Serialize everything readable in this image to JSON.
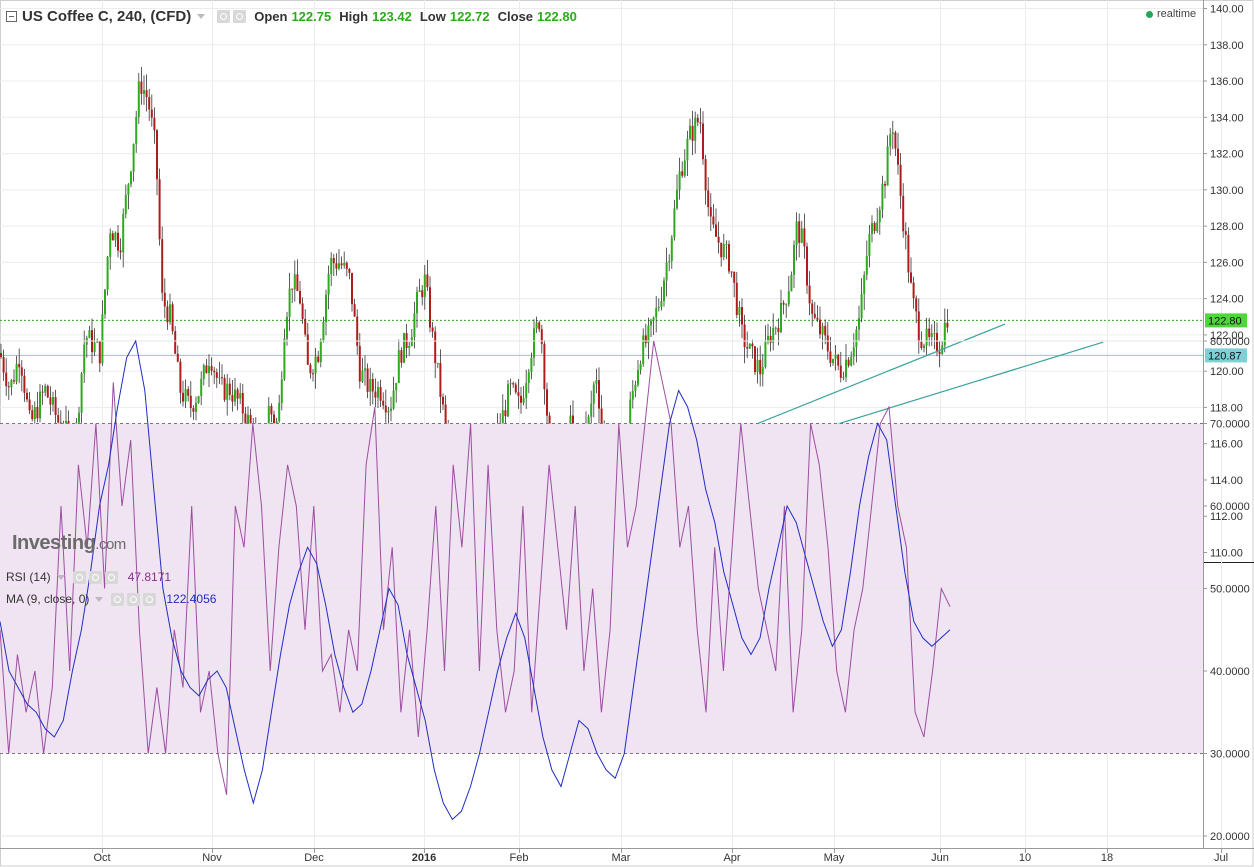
{
  "header": {
    "title": "US Coffee C, 240, (CFD)",
    "open_label": "Open",
    "open_value": "122.75",
    "high_label": "High",
    "high_value": "123.42",
    "low_label": "Low",
    "low_value": "122.72",
    "close_label": "Close",
    "close_value": "122.80",
    "realtime_label": "realtime"
  },
  "rsi_header": {
    "label": "RSI (14)",
    "value": "47.8171"
  },
  "ma_header": {
    "label": "MA (9, close, 0)",
    "value": "122.4056"
  },
  "logo": {
    "main": "Investing",
    "suffix": ".com"
  },
  "colors": {
    "up": "#2daa1d",
    "down": "#b01c1c",
    "rsi": "#9b4ea0",
    "ma": "#1f2ec2",
    "rsi_band": "#f0e4f2",
    "trend": "#3aa39a",
    "price_tag": "#4ed63a",
    "level_tag": "#7fcfd6"
  },
  "chart_data": [
    {
      "type": "candlestick",
      "title": "US Coffee C, 240, (CFD)",
      "x_ticks": [
        "Oct",
        "Nov",
        "Dec",
        "2016",
        "Feb",
        "Mar",
        "Apr",
        "May",
        "Jun",
        "10",
        "18",
        "Jul"
      ],
      "ylim": [
        109.5,
        140.5
      ],
      "y_ticks": [
        "110.00",
        "112.00",
        "114.00",
        "116.00",
        "118.00",
        "120.00",
        "122.00",
        "124.00",
        "126.00",
        "128.00",
        "130.00",
        "132.00",
        "134.00",
        "136.00",
        "138.00",
        "140.00"
      ],
      "current_price": "122.80",
      "level_line": "120.87",
      "grid": true,
      "path_series": [
        [
          0,
          121
        ],
        [
          10,
          119
        ],
        [
          20,
          121
        ],
        [
          30,
          117
        ],
        [
          45,
          119
        ],
        [
          60,
          117
        ],
        [
          75,
          116
        ],
        [
          85,
          122
        ],
        [
          100,
          121
        ],
        [
          110,
          128
        ],
        [
          120,
          127
        ],
        [
          132,
          132
        ],
        [
          140,
          136
        ],
        [
          148,
          135
        ],
        [
          156,
          132
        ],
        [
          162,
          124
        ],
        [
          170,
          123
        ],
        [
          180,
          119
        ],
        [
          190,
          118
        ],
        [
          200,
          119
        ],
        [
          210,
          121
        ],
        [
          220,
          119
        ],
        [
          230,
          119
        ],
        [
          242,
          118
        ],
        [
          250,
          117
        ],
        [
          258,
          116
        ],
        [
          262,
          112
        ],
        [
          268,
          118
        ],
        [
          278,
          117
        ],
        [
          285,
          123
        ],
        [
          292,
          125
        ],
        [
          300,
          124
        ],
        [
          308,
          120
        ],
        [
          318,
          121
        ],
        [
          330,
          126
        ],
        [
          340,
          126
        ],
        [
          350,
          125
        ],
        [
          360,
          120
        ],
        [
          370,
          119
        ],
        [
          380,
          119
        ],
        [
          390,
          118
        ],
        [
          400,
          121
        ],
        [
          410,
          122
        ],
        [
          418,
          124
        ],
        [
          425,
          125
        ],
        [
          432,
          122
        ],
        [
          440,
          119
        ],
        [
          450,
          115
        ],
        [
          460,
          115
        ],
        [
          470,
          115
        ],
        [
          482,
          111.5
        ],
        [
          490,
          115
        ],
        [
          500,
          117
        ],
        [
          510,
          119
        ],
        [
          520,
          118
        ],
        [
          530,
          121
        ],
        [
          540,
          123
        ],
        [
          548,
          117
        ],
        [
          555,
          115
        ],
        [
          563,
          113
        ],
        [
          570,
          117
        ],
        [
          578,
          116
        ],
        [
          588,
          117
        ],
        [
          596,
          120
        ],
        [
          604,
          116
        ],
        [
          612,
          116
        ],
        [
          622,
          114
        ],
        [
          630,
          118
        ],
        [
          640,
          121
        ],
        [
          650,
          122
        ],
        [
          660,
          124
        ],
        [
          670,
          127
        ],
        [
          680,
          131
        ],
        [
          690,
          133
        ],
        [
          700,
          134
        ],
        [
          710,
          128
        ],
        [
          720,
          127
        ],
        [
          730,
          126
        ],
        [
          742,
          122
        ],
        [
          750,
          121
        ],
        [
          760,
          120
        ],
        [
          770,
          122
        ],
        [
          780,
          123
        ],
        [
          790,
          125
        ],
        [
          797,
          128
        ],
        [
          803,
          127
        ],
        [
          812,
          123
        ],
        [
          822,
          122
        ],
        [
          830,
          121
        ],
        [
          840,
          120
        ],
        [
          850,
          121
        ],
        [
          860,
          123
        ],
        [
          868,
          127
        ],
        [
          878,
          129
        ],
        [
          886,
          131
        ],
        [
          892,
          134
        ],
        [
          900,
          130
        ],
        [
          906,
          127
        ],
        [
          912,
          124
        ],
        [
          920,
          122
        ],
        [
          930,
          121.5
        ],
        [
          940,
          121.5
        ],
        [
          948,
          123.2
        ]
      ],
      "trendlines": [
        {
          "from": [
            "2016-01-22",
            111.0
          ],
          "to": [
            "2016-06-17",
            122.6
          ]
        },
        {
          "from": [
            "2016-02-29",
            113.4
          ],
          "to": [
            "2016-07-01",
            121.6
          ]
        }
      ]
    },
    {
      "type": "line",
      "title": "RSI (14)",
      "ylim": [
        17,
        84
      ],
      "y_ticks": [
        "20.0000",
        "30.0000",
        "40.0000",
        "50.0000",
        "60.0000",
        "70.0000",
        "80.0000"
      ],
      "band": [
        30,
        70
      ],
      "series": [
        {
          "name": "RSI (14)",
          "values": [
            45,
            30,
            42,
            35,
            40,
            30,
            38,
            60,
            40,
            65,
            55,
            70,
            50,
            75,
            60,
            68,
            45,
            30,
            38,
            30,
            45,
            38,
            60,
            35,
            40,
            30,
            25,
            60,
            55,
            70,
            60,
            40,
            55,
            65,
            60,
            45,
            60,
            40,
            42,
            35,
            45,
            40,
            65,
            72,
            45,
            55,
            35,
            45,
            32,
            45,
            60,
            40,
            65,
            55,
            70,
            40,
            65,
            45,
            35,
            40,
            60,
            35,
            50,
            65,
            55,
            45,
            60,
            40,
            50,
            35,
            45,
            70,
            55,
            60,
            70,
            80,
            75,
            70,
            55,
            60,
            45,
            35,
            55,
            40,
            55,
            70,
            60,
            50,
            45,
            40,
            60,
            35,
            45,
            70,
            65,
            55,
            40,
            35,
            45,
            50,
            60,
            70,
            72,
            60,
            55,
            35,
            32,
            40,
            50,
            47.8
          ]
        },
        {
          "name": "MA (9, close, 0)",
          "values": [
            46,
            40,
            38,
            36,
            35,
            33,
            32,
            34,
            40,
            45,
            52,
            60,
            65,
            72,
            78,
            80,
            74,
            62,
            50,
            44,
            40,
            38,
            37,
            39,
            40,
            38,
            33,
            28,
            24,
            28,
            35,
            42,
            48,
            52,
            55,
            53,
            48,
            42,
            38,
            35,
            36,
            40,
            45,
            50,
            48,
            42,
            38,
            34,
            28,
            24,
            22,
            23,
            26,
            30,
            35,
            40,
            44,
            47,
            44,
            38,
            32,
            28,
            26,
            30,
            34,
            33,
            30,
            28,
            27,
            30,
            38,
            46,
            54,
            62,
            70,
            74,
            72,
            68,
            62,
            58,
            52,
            48,
            44,
            42,
            44,
            50,
            55,
            60,
            58,
            54,
            50,
            46,
            43,
            45,
            52,
            60,
            66,
            70,
            68,
            60,
            52,
            46,
            44,
            43,
            44,
            45
          ]
        }
      ]
    }
  ]
}
